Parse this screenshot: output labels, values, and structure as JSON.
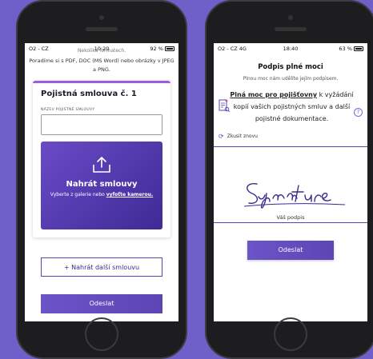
{
  "left_phone": {
    "status": {
      "carrier": "O2 - CZ",
      "time": "10:20",
      "battery": "92 %"
    },
    "scroll_hint": "Nekolika formatech.",
    "intro": "Poradíme si s PDF, DOC (MS Word) nebo obrázky v JPEG a PNG.",
    "card": {
      "title": "Pojistná smlouva č. 1",
      "field_label": "NÁZEV POJISTNÉ SMLOUVY",
      "field_value": ""
    },
    "upload": {
      "icon": "upload-tray-icon",
      "title": "Nahrát smlouvy",
      "sub_text": "Vyberte z galerie nebo",
      "sub_link": "vyfoťte kamerou."
    },
    "add_another": "+ Nahrát další smlouvu",
    "submit": "Odeslat"
  },
  "right_phone": {
    "status": {
      "carrier": "O2 - CZ  4G",
      "time": "18:40",
      "battery": "63 %"
    },
    "title": "Podpis plné moci",
    "subtitle": "Plnou moc nám udělíte jejím podpisem.",
    "poa_link": "Plná moc pro pojišťovny",
    "poa_rest": " k vyžádání kopií vašich pojistných smluv a další pojistné dokumentace.",
    "doc_icon": "document-edit-icon",
    "help_icon": "question-circle-icon",
    "help_symbol": "?",
    "retry": "Zkusit znovu",
    "retry_symbol": "⟳",
    "signature_caption": "Váš podpis",
    "send": "Odeslat"
  },
  "colors": {
    "background": "#6f5fc9",
    "accent": "#5a42b8",
    "card_top": "#9b5de5"
  }
}
